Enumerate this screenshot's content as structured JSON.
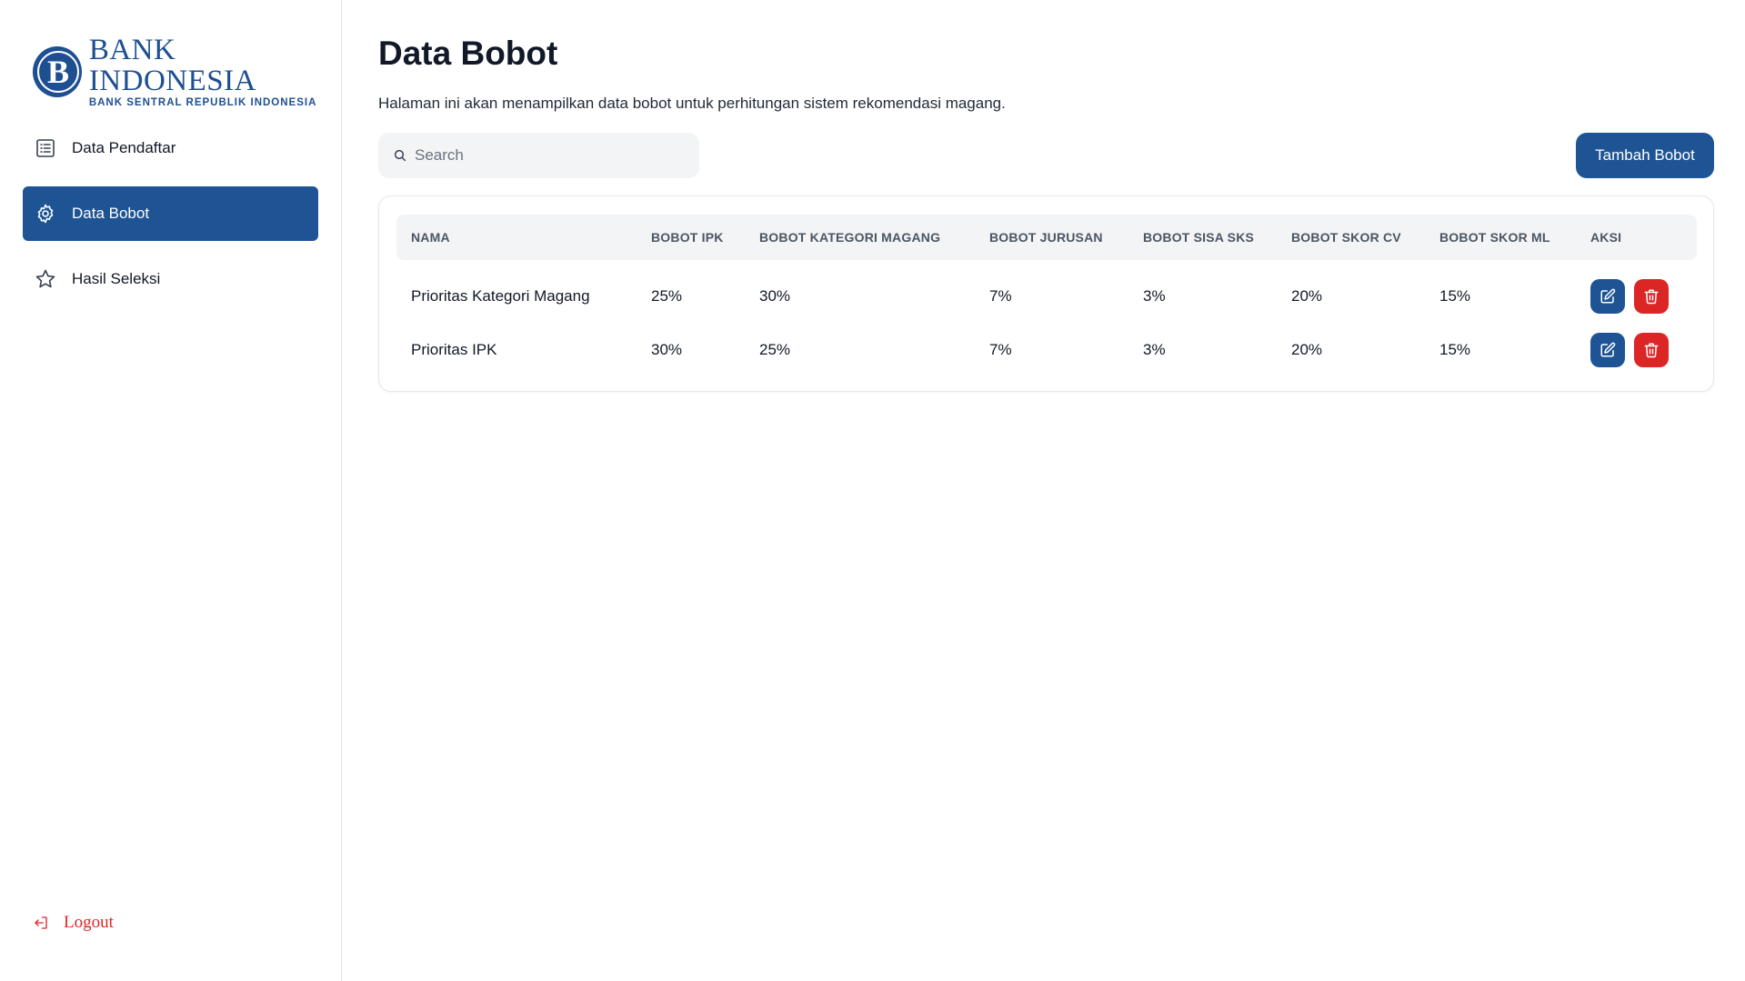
{
  "brand": {
    "title": "BANK INDONESIA",
    "subtitle": "BANK SENTRAL REPUBLIK INDONESIA",
    "color": "#1e4f91"
  },
  "sidebar": {
    "items": [
      {
        "label": "Data Pendaftar",
        "icon": "list-icon",
        "active": false
      },
      {
        "label": "Data Bobot",
        "icon": "gear-icon",
        "active": true
      },
      {
        "label": "Hasil Seleksi",
        "icon": "star-icon",
        "active": false
      }
    ],
    "logout_label": "Logout"
  },
  "page": {
    "title": "Data Bobot",
    "description": "Halaman ini akan menampilkan data bobot untuk perhitungan sistem rekomendasi magang."
  },
  "search": {
    "placeholder": "Search"
  },
  "add_button_label": "Tambah Bobot",
  "table": {
    "headers": [
      "NAMA",
      "BOBOT IPK",
      "BOBOT KATEGORI MAGANG",
      "BOBOT JURUSAN",
      "BOBOT SISA SKS",
      "BOBOT SKOR CV",
      "BOBOT SKOR ML",
      "AKSI"
    ],
    "rows": [
      [
        "Prioritas Kategori Magang",
        "25%",
        "30%",
        "7%",
        "3%",
        "20%",
        "15%"
      ],
      [
        "Prioritas IPK",
        "30%",
        "25%",
        "7%",
        "3%",
        "20%",
        "15%"
      ]
    ]
  },
  "colors": {
    "primary": "#1e5494",
    "danger": "#dc2626"
  }
}
